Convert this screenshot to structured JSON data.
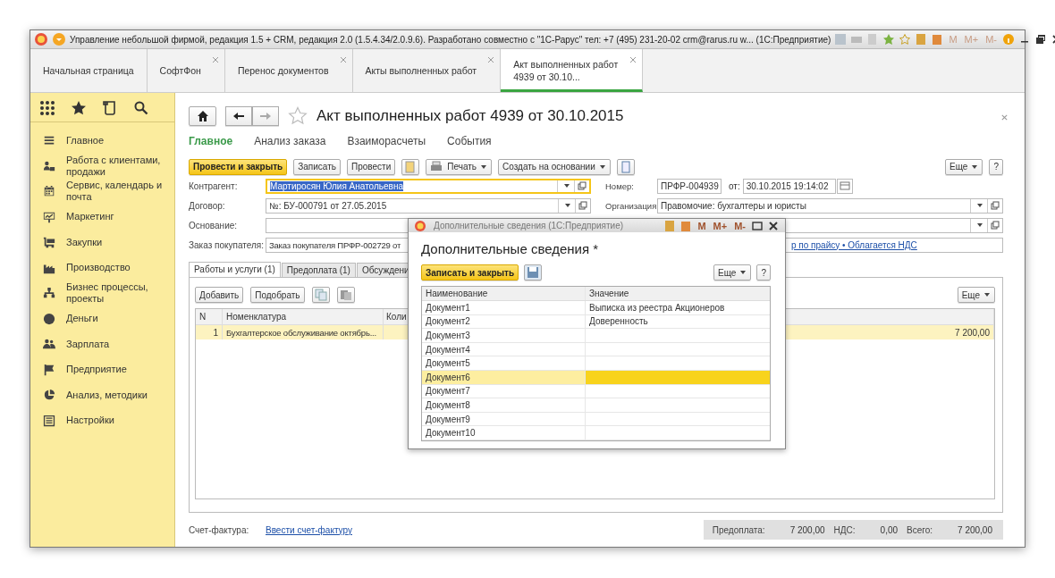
{
  "window": {
    "title": "Управление небольшой фирмой, редакция 1.5 + CRM, редакция 2.0 (1.5.4.34/2.0.9.6). Разработано совместно с \"1С-Рарус\" тел: +7 (495) 231-20-02 crm@rarus.ru w...  (1С:Предприятие)",
    "memory_buttons": [
      "M",
      "M+",
      "M-"
    ]
  },
  "tabs": [
    {
      "label": "Начальная страница",
      "selected": false,
      "closable": false
    },
    {
      "label": "СофтФон",
      "selected": false,
      "closable": true
    },
    {
      "label": "Перенос документов",
      "selected": false,
      "closable": true
    },
    {
      "label": "Акты выполненных работ",
      "selected": false,
      "closable": true
    },
    {
      "label": "Акт выполненных работ 4939 от 30.10...",
      "selected": true,
      "closable": true
    }
  ],
  "sidebar": {
    "items": [
      {
        "label": "Главное"
      },
      {
        "label": "Работа с клиентами, продажи"
      },
      {
        "label": "Сервис, календарь и почта"
      },
      {
        "label": "Маркетинг"
      },
      {
        "label": "Закупки"
      },
      {
        "label": "Производство"
      },
      {
        "label": "Бизнес процессы, проекты"
      },
      {
        "label": "Деньги"
      },
      {
        "label": "Зарплата"
      },
      {
        "label": "Предприятие"
      },
      {
        "label": "Анализ, методики"
      },
      {
        "label": "Настройки"
      }
    ]
  },
  "form": {
    "title": "Акт выполненных работ 4939 от 30.10.2015",
    "sections": [
      {
        "label": "Главное",
        "selected": true
      },
      {
        "label": "Анализ заказа",
        "selected": false
      },
      {
        "label": "Взаиморасчеты",
        "selected": false
      },
      {
        "label": "События",
        "selected": false
      }
    ],
    "commands": {
      "primary": "Провести и закрыть",
      "write": "Записать",
      "post": "Провести",
      "print": "Печать",
      "create_based": "Создать на основании",
      "more": "Еще",
      "help": "?"
    },
    "contractor": {
      "label": "Контрагент:",
      "value": "Мартиросян Юлия Анатольевна"
    },
    "number": {
      "label": "Номер:",
      "value": "ПРФР-004939",
      "date_label": "от:",
      "date": "30.10.2015 19:14:02"
    },
    "contract": {
      "label": "Договор:",
      "value": "№: БУ-000791 от 27.05.2015"
    },
    "organization": {
      "label": "Организация:",
      "value": "Правомочие: бухгалтеры и юристы"
    },
    "basis": {
      "label": "Основание:"
    },
    "order": {
      "label": "Заказ покупателя:",
      "value": "Заказ покупателя ПРФР-002729 от",
      "link": "р по прайсу • Облагается НДС"
    },
    "inner_tabs": [
      {
        "label": "Работы и услуги (1)",
        "selected": true
      },
      {
        "label": "Предоплата (1)",
        "selected": false
      },
      {
        "label": "Обсуждени",
        "selected": false
      }
    ],
    "table_buttons": {
      "add": "Добавить",
      "pick": "Подобрать",
      "more": "Еще"
    },
    "table": {
      "columns": [
        "N",
        "Номенклатура",
        "Коли"
      ],
      "rows": [
        {
          "n": "1",
          "item": "Бухгалтерское обслуживание октябрь...",
          "amount": "7 200,00",
          "selected": true
        }
      ]
    },
    "footer": {
      "invoice_label": "Счет-фактура:",
      "invoice_link": "Ввести счет-фактуру",
      "prepay_label": "Предоплата:",
      "prepay": "7 200,00",
      "vat_label": "НДС:",
      "vat": "0,00",
      "total_label": "Всего:",
      "total": "7 200,00"
    }
  },
  "dialog": {
    "title": "Дополнительные сведения  (1С:Предприятие)",
    "memory_buttons": [
      "M",
      "M+",
      "M-"
    ],
    "heading": "Дополнительные сведения *",
    "save_close": "Записать и закрыть",
    "more": "Еще",
    "help": "?",
    "columns": [
      "Наименование",
      "Значение"
    ],
    "rows": [
      {
        "name": "Документ1",
        "value": "Выписка из реестра Акционеров",
        "selected": false
      },
      {
        "name": "Документ2",
        "value": "Доверенность",
        "selected": false
      },
      {
        "name": "Документ3",
        "selected": false
      },
      {
        "name": "Документ4",
        "selected": false
      },
      {
        "name": "Документ5",
        "selected": false
      },
      {
        "name": "Документ6",
        "selected": true
      },
      {
        "name": "Документ7",
        "selected": false
      },
      {
        "name": "Документ8",
        "selected": false
      },
      {
        "name": "Документ9",
        "selected": false
      },
      {
        "name": "Документ10",
        "selected": false
      }
    ]
  }
}
